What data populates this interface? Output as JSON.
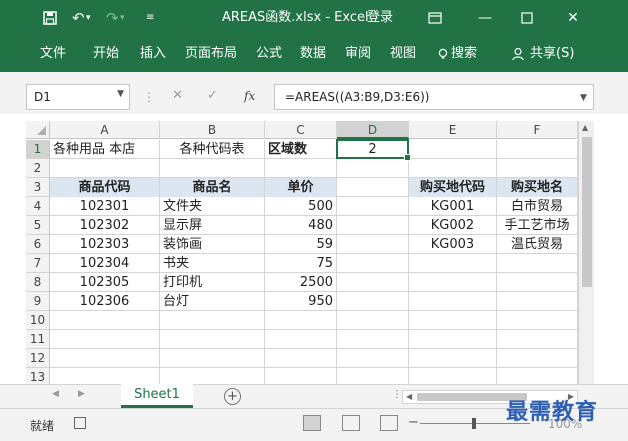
{
  "titlebar": {
    "save_icon": "floppy-disk-icon",
    "undo_icon": "undo-icon",
    "redo_icon": "redo-icon",
    "customize_icon": "quick-access-dropdown-icon",
    "title": "AREAS函数.xlsx  -  Excel",
    "login": "登录",
    "ribbon_display_icon": "ribbon-display-options-icon",
    "minimize_icon": "minimize-icon",
    "maximize_icon": "maximize-icon",
    "close_icon": "close-icon"
  },
  "ribbon": {
    "tabs": [
      "文件",
      "开始",
      "插入",
      "页面布局",
      "公式",
      "数据",
      "审阅",
      "视图"
    ],
    "search": "搜索",
    "share": "共享(S)"
  },
  "formula_bar": {
    "name_box": "D1",
    "cancel_glyph": "✕",
    "enter_glyph": "✓",
    "fx_label": "fx",
    "formula": "=AREAS((A3:B9,D3:E6))"
  },
  "columns": [
    "A",
    "B",
    "C",
    "D",
    "E",
    "F"
  ],
  "rows": [
    "1",
    "2",
    "3",
    "4",
    "5",
    "6",
    "7",
    "8",
    "9",
    "10",
    "11",
    "12",
    "13"
  ],
  "cells": {
    "A1": "各种用品 本店",
    "B1": "各种代码表",
    "C1": "区域数",
    "D1": "2",
    "A3": "商品代码",
    "B3": "商品名",
    "C3": "单价",
    "E3": "购买地代码",
    "F3": "购买地名",
    "A4": "102301",
    "B4": "文件夹",
    "C4": "500",
    "E4": "KG001",
    "F4": "白市贸易",
    "A5": "102302",
    "B5": "显示屏",
    "C5": "480",
    "E5": "KG002",
    "F5": "手工艺市场",
    "A6": "102303",
    "B6": "装饰画",
    "C6": "59",
    "E6": "KG003",
    "F6": "温氏贸易",
    "A7": "102304",
    "B7": "书夹",
    "C7": "75",
    "A8": "102305",
    "B8": "打印机",
    "C8": "2500",
    "A9": "102306",
    "B9": "台灯",
    "C9": "950"
  },
  "sheet_tabs": [
    "Sheet1"
  ],
  "add_sheet_glyph": "+",
  "status": {
    "ready": "就绪",
    "zoom_minus": "−",
    "zoom": "100%"
  },
  "watermark": "最需教育"
}
